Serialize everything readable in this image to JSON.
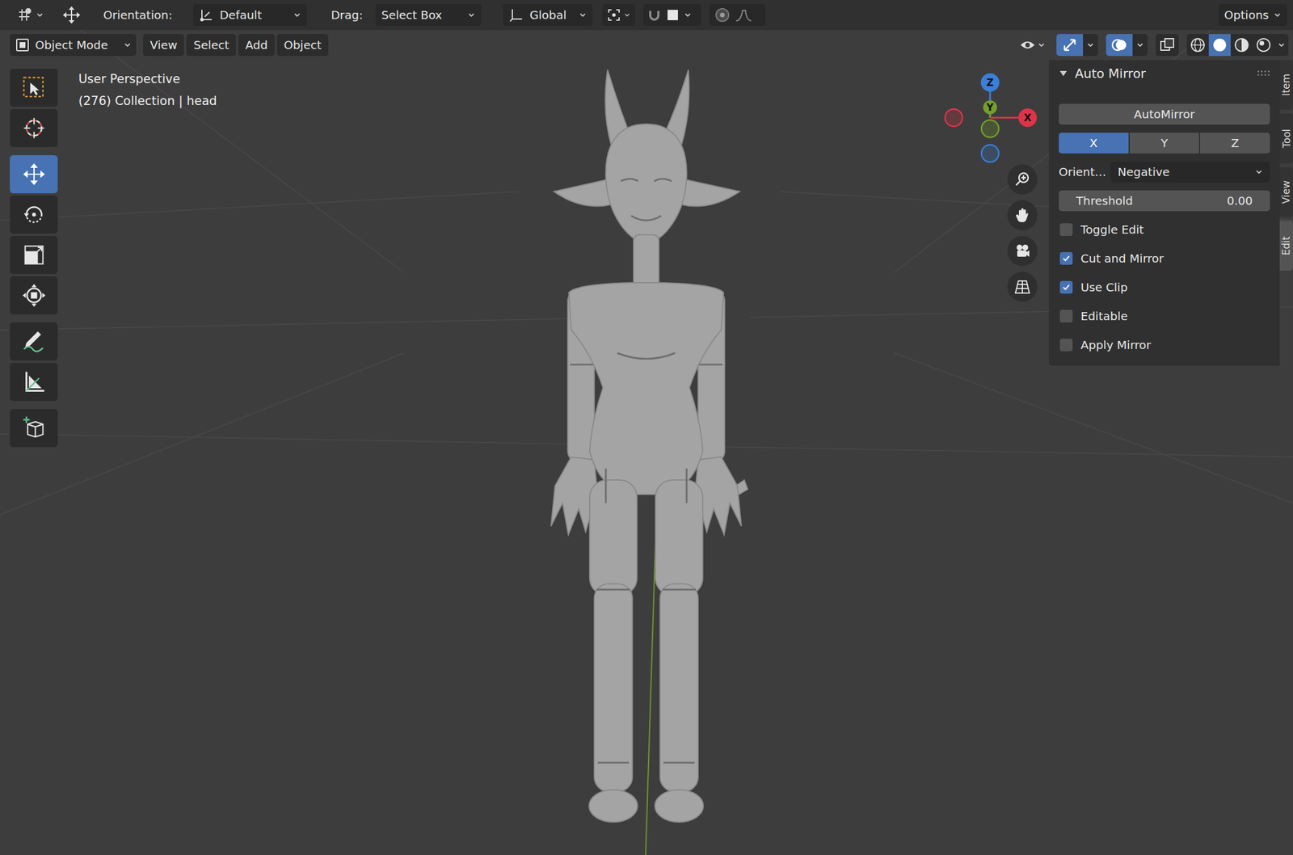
{
  "header": {
    "orientation_label": "Orientation:",
    "orientation": "Default",
    "drag_label": "Drag:",
    "drag": "Select Box",
    "transform_space": "Global",
    "options": "Options"
  },
  "menubar": {
    "mode": "Object Mode",
    "menus": [
      "View",
      "Select",
      "Add",
      "Object"
    ],
    "show_gizmo": true,
    "show_overlays": true,
    "xray": false,
    "shading": [
      {
        "kind": "wireframe",
        "selected": false
      },
      {
        "kind": "solid",
        "selected": true
      },
      {
        "kind": "material",
        "selected": false
      },
      {
        "kind": "rendered",
        "selected": false
      }
    ]
  },
  "viewport": {
    "perspective": "User Perspective",
    "info": "(276) Collection | head"
  },
  "toolbar": [
    {
      "kind": "select",
      "selected": false
    },
    {
      "kind": "cursor",
      "selected": false
    },
    {
      "kind": "move",
      "selected": true
    },
    {
      "kind": "rotate",
      "selected": false
    },
    {
      "kind": "scale",
      "selected": false
    },
    {
      "kind": "transform",
      "selected": false
    },
    {
      "kind": "annotate",
      "selected": false
    },
    {
      "kind": "measure",
      "selected": false
    },
    {
      "kind": "add-cube",
      "selected": false
    }
  ],
  "gizmo": [
    {
      "label": "Z",
      "color": "#3b7fd9"
    },
    {
      "label": "Y",
      "color": "#74a02a"
    },
    {
      "label": "X",
      "color": "#dc3549"
    }
  ],
  "panel": {
    "title": "Auto Mirror",
    "button": "AutoMirror",
    "axes": [
      {
        "label": "X",
        "selected": true
      },
      {
        "label": "Y",
        "selected": false
      },
      {
        "label": "Z",
        "selected": false
      }
    ],
    "orient_label": "Orient…",
    "orient": "Negative",
    "threshold_label": "Threshold",
    "threshold": "0.00",
    "options": [
      {
        "label": "Toggle Edit",
        "checked": false
      },
      {
        "label": "Cut and Mirror",
        "checked": true
      },
      {
        "label": "Use Clip",
        "checked": true
      },
      {
        "label": "Editable",
        "checked": false
      },
      {
        "label": "Apply Mirror",
        "checked": false
      }
    ]
  },
  "sidebar_tabs": [
    {
      "label": "Item",
      "selected": false
    },
    {
      "label": "Tool",
      "selected": false
    },
    {
      "label": "View",
      "selected": false
    },
    {
      "label": "Edit",
      "selected": true
    }
  ]
}
